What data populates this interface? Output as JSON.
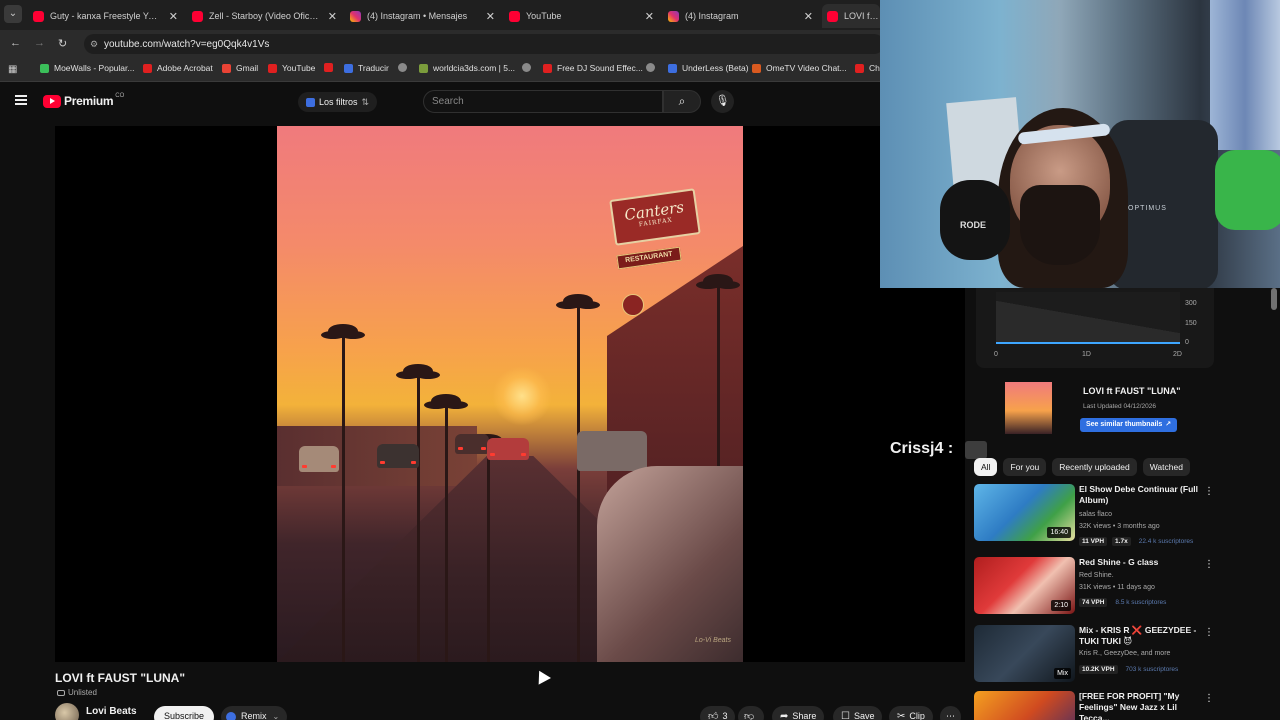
{
  "browser": {
    "tabs": [
      {
        "title": "Guty - kanxa Freestyle Ya dispo",
        "icon": "youtube-icon"
      },
      {
        "title": "Zell - Starboy (Video Oficial) - Y",
        "icon": "youtube-icon"
      },
      {
        "title": "(4) Instagram • Mensajes",
        "icon": "instagram-icon"
      },
      {
        "title": "YouTube",
        "icon": "youtube-icon"
      },
      {
        "title": "(4) Instagram",
        "icon": "instagram-icon"
      },
      {
        "title": "LOVI ft FAU",
        "icon": "youtube-icon"
      }
    ],
    "url": "youtube.com/watch?v=eg0Qqk4v1Vs",
    "bookmarks": [
      "MoeWalls - Popular...",
      "Adobe Acrobat",
      "Gmail",
      "YouTube",
      "",
      "Traducir",
      "",
      "worldcia3ds.com | 5...",
      "Free DJ Sound Effec...",
      "",
      "UnderLess (Beta)",
      "OmeTV Video Chat...",
      "Ch"
    ]
  },
  "youtube": {
    "brand": "Premium",
    "country": "CO",
    "filters_label": "Los filtros",
    "search_placeholder": "Search"
  },
  "artwork": {
    "sign_main": "Canters",
    "sign_sub": "FAIRFAX",
    "sign_restaurant": "RESTAURANT",
    "watermark": "Lo-Vi Beats"
  },
  "video": {
    "title": "LOVI ft FAUST \"LUNA\"",
    "visibility": "Unlisted",
    "channel": "Lovi Beats",
    "subscribe_label": "Subscribe",
    "remix_label": "Remix",
    "likes": "3",
    "share_label": "Share",
    "save_label": "Save",
    "clip_label": "Clip"
  },
  "stats_panel": {
    "y_ticks": [
      "300",
      "150",
      "0"
    ],
    "x_ticks": [
      "0",
      "1D",
      "2D"
    ],
    "thumb_title": "LOVI ft FAUST \"LUNA\"",
    "last_updated": "Last Updated 04/12/2026",
    "similar_label": "See similar thumbnails"
  },
  "chat_overlay": {
    "name": "Crissj4 :"
  },
  "webcam": {
    "chair_logo": "OPTIMUS",
    "mic_logo": "RODE"
  },
  "recs": {
    "chips": [
      "All",
      "For you",
      "Recently uploaded",
      "Watched"
    ],
    "items": [
      {
        "title": "El Show Debe Continuar (Full Album)",
        "channel": "salas flaco",
        "meta": "32K views • 3 months ago",
        "vph": "11 VPH",
        "mult": "1.7x",
        "subs": "22.4 k suscriptores",
        "duration": "16:40"
      },
      {
        "title": "Red Shine - G class",
        "channel": "Red Shine.",
        "meta": "31K views • 11 days ago",
        "vph": "74 VPH",
        "mult": "",
        "subs": "8.5 k suscriptores",
        "duration": "2:10"
      },
      {
        "title": "Mix - KRIS R ❌ GEEZYDEE - TUKI TUKI 😈",
        "channel": "Kris R., GeezyDee, and more",
        "meta": "",
        "vph": "10.2K VPH",
        "mult": "",
        "subs": "703 k suscriptores",
        "duration": "Mix"
      },
      {
        "title": "[FREE FOR PROFIT] \"My Feelings\" New Jazz x Lil Tecca...",
        "channel": "",
        "meta": "",
        "vph": "",
        "mult": "",
        "subs": "",
        "duration": ""
      }
    ]
  },
  "colors": {
    "page_bg": "#0f0f0f",
    "youtube_red": "#ff0033",
    "accent_blue": "#3ea6ff",
    "similar_btn": "#2f6fe0"
  }
}
